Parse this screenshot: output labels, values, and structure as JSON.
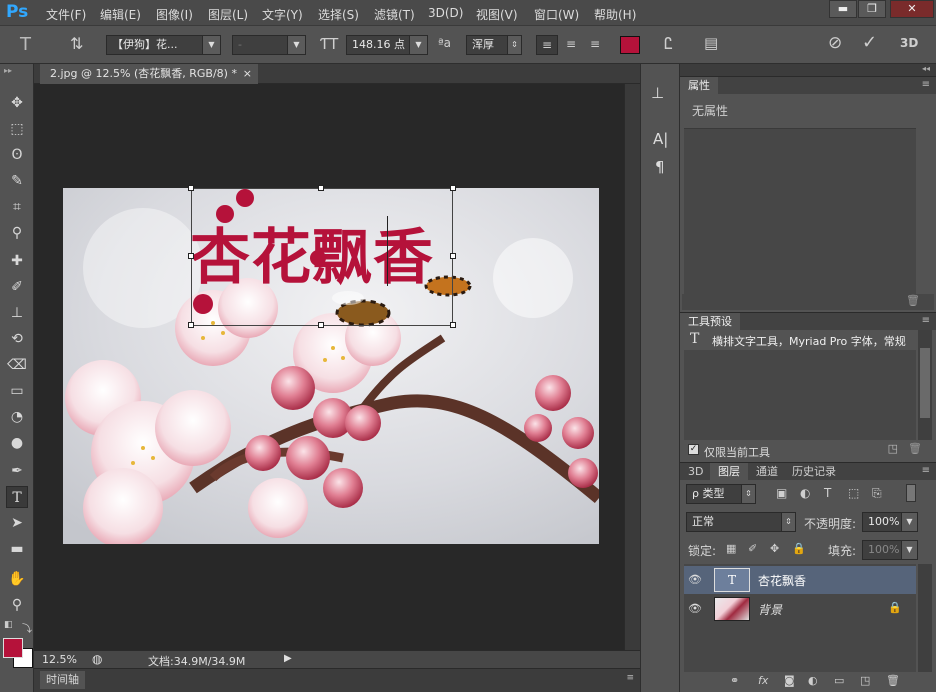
{
  "app": {
    "logo": "Ps"
  },
  "menu": [
    "文件(F)",
    "编辑(E)",
    "图像(I)",
    "图层(L)",
    "文字(Y)",
    "选择(S)",
    "滤镜(T)",
    "3D(D)",
    "视图(V)",
    "窗口(W)",
    "帮助(H)"
  ],
  "window_controls": {
    "minimize": "▬",
    "restore": "❐",
    "close": "✕"
  },
  "options": {
    "tool_glyph": "T",
    "font_family": "【伊狗】花...",
    "font_style": "-",
    "font_size": "148.16 点",
    "aa_label": "ªa",
    "antialias": "浑厚",
    "text_color": "#b5123a",
    "threed": "3D"
  },
  "document": {
    "tab_title": "2.jpg @ 12.5% (杏花飘香, RGB/8) *",
    "tab_close": "×",
    "overlay_text": "杏花飘香",
    "overlay_color": "#b5123a"
  },
  "status": {
    "zoom": "12.5%",
    "doc_info": "文档:34.9M/34.9M"
  },
  "timeline": {
    "label": "时间轴"
  },
  "properties": {
    "tab": "属性",
    "content": "无属性"
  },
  "tool_presets": {
    "tab": "工具预设",
    "item_icon": "T",
    "item": "横排文字工具，Myriad Pro 字体，常规",
    "current_only": "仅限当前工具"
  },
  "layers_panel": {
    "tabs": [
      "3D",
      "图层",
      "通道",
      "历史记录"
    ],
    "active_tab": "图层",
    "filter_kind": "类型",
    "filter_prefix": "ρ",
    "blend_mode": "正常",
    "opacity_label": "不透明度:",
    "opacity": "100%",
    "lock_label": "锁定:",
    "fill_label": "填充:",
    "fill": "100%",
    "layers": [
      {
        "name": "杏花飘香",
        "type": "text",
        "thumb": "T",
        "selected": true
      },
      {
        "name": "背景",
        "type": "image",
        "locked": true,
        "selected": false
      }
    ]
  },
  "colors": {
    "foreground": "#b5123a",
    "background": "#ffffff",
    "accent": "#31a8ff"
  }
}
